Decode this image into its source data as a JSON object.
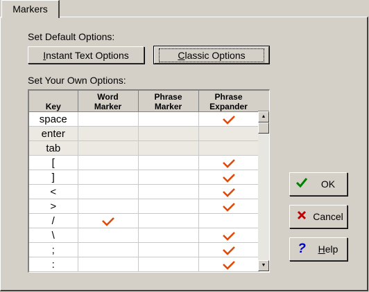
{
  "tab": {
    "label": "Markers"
  },
  "default_section": {
    "label": "Set Default Options:",
    "instant_button": {
      "pre": "",
      "u": "I",
      "post": "nstant Text Options"
    },
    "classic_button": {
      "pre": "",
      "u": "C",
      "post": "lassic Options"
    }
  },
  "own_section": {
    "label": "Set Your Own Options:"
  },
  "table": {
    "headers": [
      {
        "line1": "",
        "line2": "Key"
      },
      {
        "line1": "Word",
        "line2": "Marker"
      },
      {
        "line1": "Phrase",
        "line2": "Marker"
      },
      {
        "line1": "Phrase",
        "line2": "Expander"
      }
    ],
    "rows": [
      {
        "key": "space",
        "word_marker": false,
        "phrase_marker": false,
        "phrase_expander": true,
        "highlighted": false
      },
      {
        "key": "enter",
        "word_marker": false,
        "phrase_marker": false,
        "phrase_expander": false,
        "highlighted": true
      },
      {
        "key": "tab",
        "word_marker": false,
        "phrase_marker": false,
        "phrase_expander": false,
        "highlighted": true
      },
      {
        "key": "[",
        "word_marker": false,
        "phrase_marker": false,
        "phrase_expander": true,
        "highlighted": false
      },
      {
        "key": "]",
        "word_marker": false,
        "phrase_marker": false,
        "phrase_expander": true,
        "highlighted": false
      },
      {
        "key": "<",
        "word_marker": false,
        "phrase_marker": false,
        "phrase_expander": true,
        "highlighted": false
      },
      {
        "key": ">",
        "word_marker": false,
        "phrase_marker": false,
        "phrase_expander": true,
        "highlighted": false
      },
      {
        "key": "/",
        "word_marker": true,
        "phrase_marker": false,
        "phrase_expander": false,
        "highlighted": false
      },
      {
        "key": "\\",
        "word_marker": false,
        "phrase_marker": false,
        "phrase_expander": true,
        "highlighted": false
      },
      {
        "key": ";",
        "word_marker": false,
        "phrase_marker": false,
        "phrase_expander": true,
        "highlighted": false
      },
      {
        "key": ":",
        "word_marker": false,
        "phrase_marker": false,
        "phrase_expander": true,
        "highlighted": false
      }
    ]
  },
  "side_buttons": {
    "ok": {
      "label": "OK",
      "icon": "check-icon",
      "icon_color": "#008000"
    },
    "cancel": {
      "label": "Cancel",
      "icon": "x-icon",
      "icon_color": "#c00000"
    },
    "help": {
      "pre": "",
      "u": "H",
      "post": "elp",
      "icon": "question-icon",
      "icon_color": "#0000c0"
    }
  },
  "colors": {
    "check": "#e04a0a",
    "face": "#d4d0c8"
  }
}
